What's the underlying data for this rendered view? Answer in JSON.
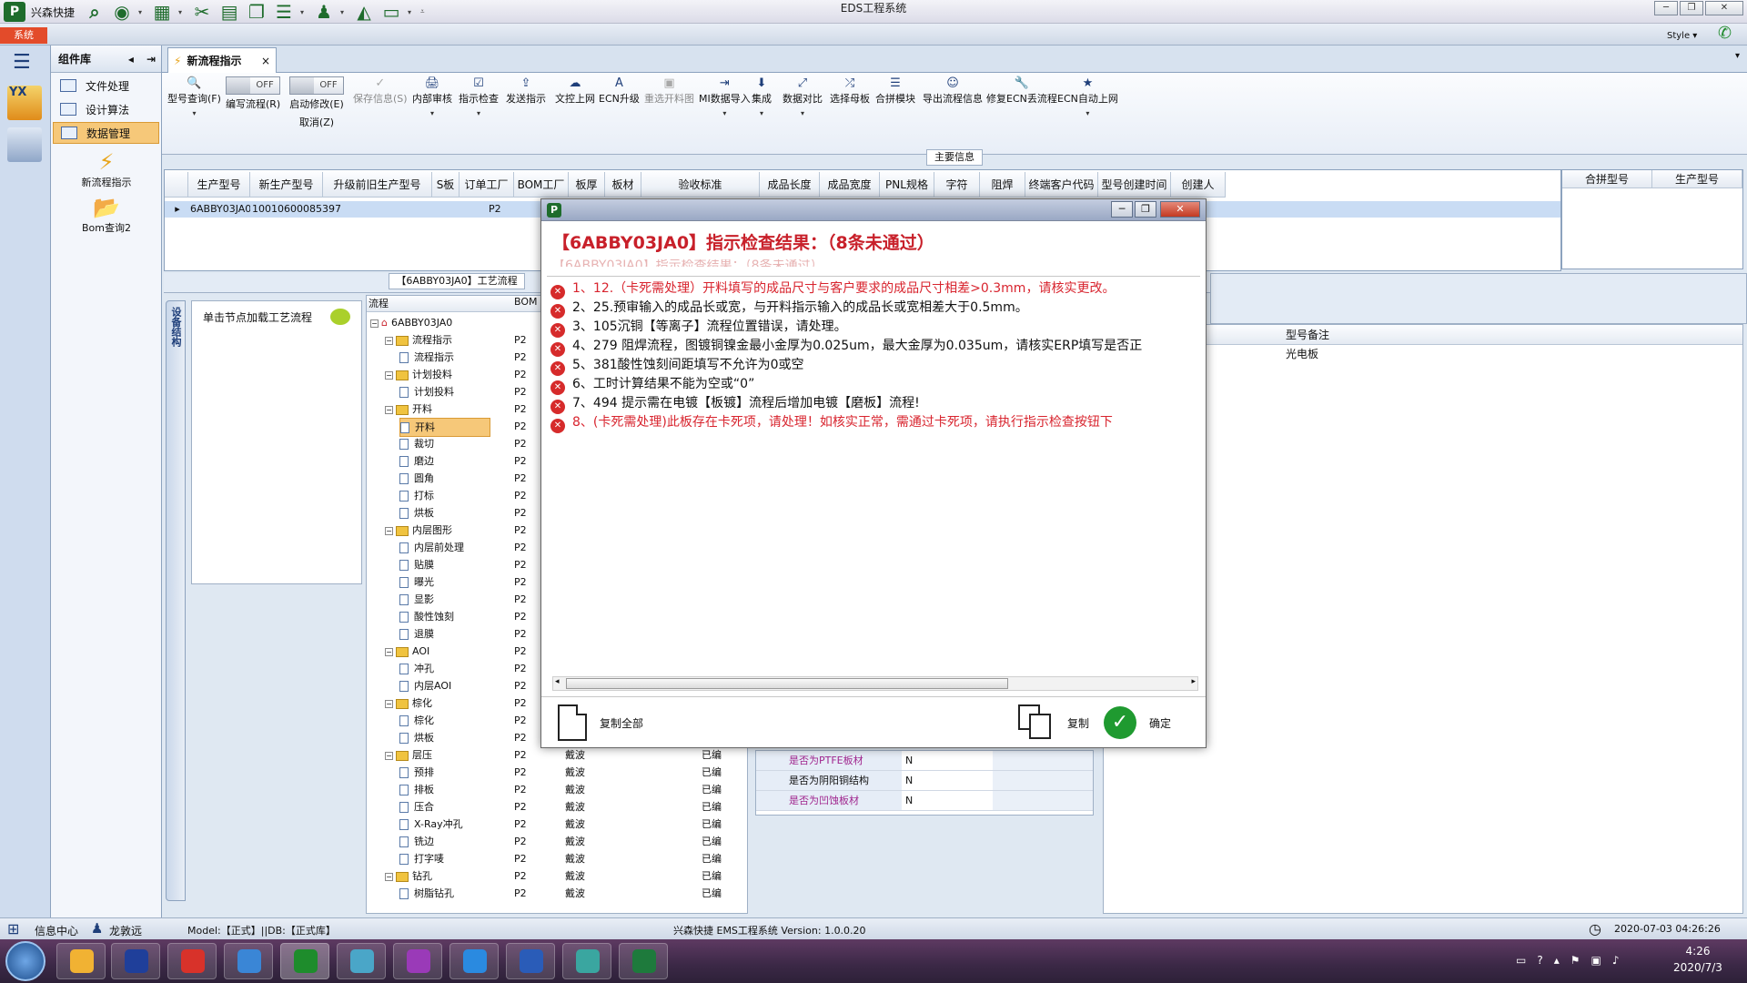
{
  "app": {
    "quick_access_label": "兴森快捷",
    "window_title": "EDS工程系统",
    "style_label": "Style",
    "system_button": "系统"
  },
  "nav": {
    "header": "组件库",
    "items": [
      {
        "label": "文件处理",
        "selected": false
      },
      {
        "label": "设计算法",
        "selected": false
      },
      {
        "label": "数据管理",
        "selected": true
      }
    ],
    "big_items": [
      {
        "label": "新流程指示"
      },
      {
        "label": "Bom查询2"
      }
    ]
  },
  "tabs": [
    {
      "label": "新流程指示",
      "close": "×"
    }
  ],
  "toolbar": {
    "items": [
      {
        "label": "型号查询(F)",
        "icon": "🔍"
      },
      {
        "label": "编写流程(R)",
        "toggle": "OFF"
      },
      {
        "label": "启动修改(E)",
        "sub": "取消(Z)",
        "toggle": "OFF"
      },
      {
        "label": "保存信息(S)",
        "icon": "✓",
        "disabled": true
      },
      {
        "label": "内部审核",
        "icon": "🖨"
      },
      {
        "label": "指示检查",
        "icon": "☑"
      },
      {
        "label": "发送指示",
        "icon": "⇪"
      },
      {
        "label": "文控上网",
        "icon": "☁"
      },
      {
        "label": "ECN升级",
        "icon": "A"
      },
      {
        "label": "重选开料图",
        "icon": "▣",
        "disabled": true
      },
      {
        "label": "MI数据导入",
        "icon": "⇥"
      },
      {
        "label": "集成",
        "icon": "⬇"
      },
      {
        "label": "数据对比",
        "icon": "⤢"
      },
      {
        "label": "选择母板",
        "icon": "⤮"
      },
      {
        "label": "合拼模块",
        "icon": "☰"
      },
      {
        "label": "导出流程信息",
        "icon": "☺"
      },
      {
        "label": "修复ECN丢流程",
        "icon": "🔧"
      },
      {
        "label": "ECN自动上网",
        "icon": "★"
      }
    ],
    "main_info_label": "主要信息"
  },
  "grid": {
    "columns": [
      "生产型号",
      "新生产型号",
      "升级前旧生产型号",
      "S板",
      "订单工厂",
      "BOM工厂",
      "板厚",
      "板材",
      "验收标准",
      "成品长度",
      "成品宽度",
      "PNL规格",
      "字符",
      "阻焊",
      "终端客户代码",
      "型号创建时间",
      "创建人"
    ],
    "row": {
      "c1": "6ABBY03JA0",
      "c2": "10010600085397",
      "c5": "P2"
    },
    "right_columns": [
      "合拼型号",
      "生产型号"
    ]
  },
  "process": {
    "label": "【6ABBY03JA0】工艺流程",
    "side_tab": "设备结构",
    "click_hint": "单击节点加载工艺流程",
    "tree_header": {
      "col1": "流程",
      "col2": "BOM"
    },
    "rows": [
      {
        "label": "6ABBY03JA0",
        "level": 0,
        "type": "root",
        "bom": ""
      },
      {
        "label": "流程指示",
        "level": 1,
        "type": "folder",
        "bom": "P2"
      },
      {
        "label": "流程指示",
        "level": 2,
        "type": "page",
        "bom": "P2"
      },
      {
        "label": "计划投料",
        "level": 1,
        "type": "folder",
        "bom": "P2"
      },
      {
        "label": "计划投料",
        "level": 2,
        "type": "page",
        "bom": "P2"
      },
      {
        "label": "开料",
        "level": 1,
        "type": "folder",
        "bom": "P2"
      },
      {
        "label": "开料",
        "level": 2,
        "type": "page",
        "bom": "P2",
        "highlight": true
      },
      {
        "label": "裁切",
        "level": 2,
        "type": "page",
        "bom": "P2"
      },
      {
        "label": "磨边",
        "level": 2,
        "type": "page",
        "bom": "P2"
      },
      {
        "label": "圆角",
        "level": 2,
        "type": "page",
        "bom": "P2"
      },
      {
        "label": "打标",
        "level": 2,
        "type": "page",
        "bom": "P2"
      },
      {
        "label": "烘板",
        "level": 2,
        "type": "page",
        "bom": "P2"
      },
      {
        "label": "内层图形",
        "level": 1,
        "type": "folder",
        "bom": "P2"
      },
      {
        "label": "内层前处理",
        "level": 2,
        "type": "page",
        "bom": "P2"
      },
      {
        "label": "贴膜",
        "level": 2,
        "type": "page",
        "bom": "P2"
      },
      {
        "label": "曝光",
        "level": 2,
        "type": "page",
        "bom": "P2"
      },
      {
        "label": "显影",
        "level": 2,
        "type": "page",
        "bom": "P2"
      },
      {
        "label": "酸性蚀刻",
        "level": 2,
        "type": "page",
        "bom": "P2"
      },
      {
        "label": "退膜",
        "level": 2,
        "type": "page",
        "bom": "P2"
      },
      {
        "label": "AOI",
        "level": 1,
        "type": "folder",
        "bom": "P2"
      },
      {
        "label": "冲孔",
        "level": 2,
        "type": "page",
        "bom": "P2"
      },
      {
        "label": "内层AOI",
        "level": 2,
        "type": "page",
        "bom": "P2"
      },
      {
        "label": "棕化",
        "level": 1,
        "type": "folder",
        "bom": "P2"
      },
      {
        "label": "棕化",
        "level": 2,
        "type": "page",
        "bom": "P2"
      },
      {
        "label": "烘板",
        "level": 2,
        "type": "page",
        "bom": "P2"
      },
      {
        "label": "层压",
        "level": 1,
        "type": "folder",
        "bom": "P2",
        "c3": "戴波",
        "c4": "已编"
      },
      {
        "label": "预排",
        "level": 2,
        "type": "page",
        "bom": "P2",
        "c3": "戴波",
        "c4": "已编"
      },
      {
        "label": "排板",
        "level": 2,
        "type": "page",
        "bom": "P2",
        "c3": "戴波",
        "c4": "已编"
      },
      {
        "label": "压合",
        "level": 2,
        "type": "page",
        "bom": "P2",
        "c3": "戴波",
        "c4": "已编"
      },
      {
        "label": "X-Ray冲孔",
        "level": 2,
        "type": "page",
        "bom": "P2",
        "c3": "戴波",
        "c4": "已编"
      },
      {
        "label": "铣边",
        "level": 2,
        "type": "page",
        "bom": "P2",
        "c3": "戴波",
        "c4": "已编"
      },
      {
        "label": "打字唛",
        "level": 2,
        "type": "page",
        "bom": "P2",
        "c3": "戴波",
        "c4": "已编"
      },
      {
        "label": "钻孔",
        "level": 1,
        "type": "folder",
        "bom": "P2",
        "c3": "戴波",
        "c4": "已编"
      },
      {
        "label": "树脂钻孔",
        "level": 2,
        "type": "page",
        "bom": "P2",
        "c3": "戴波",
        "c4": "已编"
      }
    ]
  },
  "properties": [
    {
      "key": "是否为PTFE板材",
      "value": "N"
    },
    {
      "key": "是否为阴阳铜结构",
      "value": "N"
    },
    {
      "key": "是否为凹蚀板材",
      "value": "N"
    }
  ],
  "right_panel": {
    "header": "型号备注",
    "value": "光电板"
  },
  "dialog": {
    "title": "【6ABBY03JA0】指示检查结果：（8条未通过）",
    "subtitle": "【6ABBY03JA0】指示检查结果：（8条未通过）",
    "messages": [
      {
        "text": "1、12.（卡死需处理）开料填写的成品尺寸与客户要求的成品尺寸相差>0.3mm，请核实更改。",
        "red": true
      },
      {
        "text": "2、25.预审输入的成品长或宽，与开料指示输入的成品长或宽相差大于0.5mm。",
        "red": false
      },
      {
        "text": "3、105沉铜【等离子】流程位置错误，请处理。",
        "red": false
      },
      {
        "text": "4、279 阻焊流程，图镀铜镍金最小金厚为0.025um，最大金厚为0.035um，请核实ERP填写是否正",
        "red": false
      },
      {
        "text": "5、381酸性蚀刻间距填写不允许为0或空",
        "red": false
      },
      {
        "text": "6、工时计算结果不能为空或“0”",
        "red": false
      },
      {
        "text": "7、494 提示需在电镀【板镀】流程后增加电镀【磨板】流程!",
        "red": false
      },
      {
        "text": "8、(卡死需处理)此板存在卡死项，请处理！如核实正常，需通过卡死项，请执行指示检查按钮下",
        "red": true
      }
    ],
    "copy_all": "复制全部",
    "copy": "复制",
    "ok": "确定"
  },
  "status": {
    "info_center": "信息中心",
    "user": "龙敦远",
    "model": "Model:【正式】||DB:【正式库】",
    "version": "兴森快捷 EMS工程系统 Version: 1.0.0.20",
    "datetime": "2020-07-03 04:26:26"
  },
  "taskbar": {
    "time": "4:26",
    "date": "2020/7/3"
  }
}
